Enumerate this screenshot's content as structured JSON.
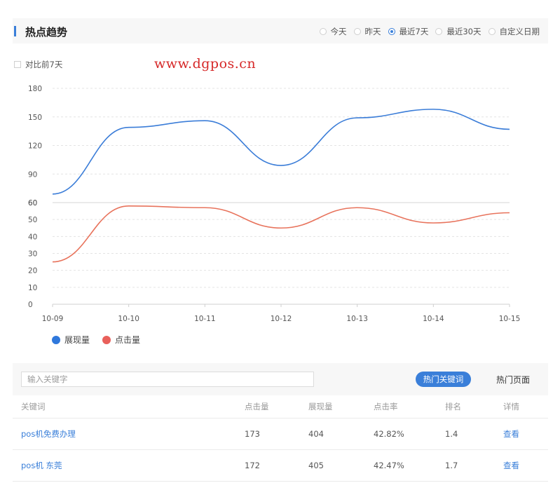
{
  "header": {
    "title": "热点趋势",
    "ranges": [
      {
        "label": "今天",
        "selected": false
      },
      {
        "label": "昨天",
        "selected": false
      },
      {
        "label": "最近7天",
        "selected": true
      },
      {
        "label": "最近30天",
        "selected": false
      },
      {
        "label": "自定义日期",
        "selected": false
      }
    ]
  },
  "compare_label": "对比前7天",
  "watermark": "www.dgpos.cn",
  "chart_data": {
    "type": "line",
    "categories": [
      "10-09",
      "10-10",
      "10-11",
      "10-12",
      "10-13",
      "10-14",
      "10-15"
    ],
    "series": [
      {
        "name": "展现量",
        "color": "#3b7dd8",
        "values": [
          69,
          139,
          146,
          99,
          149,
          158,
          137
        ]
      },
      {
        "name": "点击量",
        "color": "#e8735c",
        "values": [
          25,
          58,
          57,
          45,
          57,
          48,
          54
        ]
      }
    ],
    "upper_axis": {
      "ticks": [
        60,
        90,
        120,
        150,
        180
      ],
      "range": [
        60,
        180
      ]
    },
    "lower_axis": {
      "ticks": [
        0,
        10,
        20,
        30,
        40,
        50,
        60
      ],
      "range": [
        0,
        60
      ]
    },
    "grid": true,
    "legend_position": "bottom-left"
  },
  "legend": [
    {
      "label": "展现量",
      "color": "#2f78dc"
    },
    {
      "label": "点击量",
      "color": "#e9605b"
    }
  ],
  "keyword_panel": {
    "search_placeholder": "输入关键字",
    "tab_hot_keywords": "热门关键词",
    "tab_hot_pages": "热门页面"
  },
  "table": {
    "columns": [
      "关键词",
      "点击量",
      "展现量",
      "点击率",
      "排名",
      "详情"
    ],
    "rows": [
      {
        "keyword": "pos机免费办理",
        "clicks": "173",
        "impressions": "404",
        "ctr": "42.82%",
        "rank": "1.4",
        "detail": "查看"
      },
      {
        "keyword": "pos机 东莞",
        "clicks": "172",
        "impressions": "405",
        "ctr": "42.47%",
        "rank": "1.7",
        "detail": "查看"
      }
    ]
  }
}
